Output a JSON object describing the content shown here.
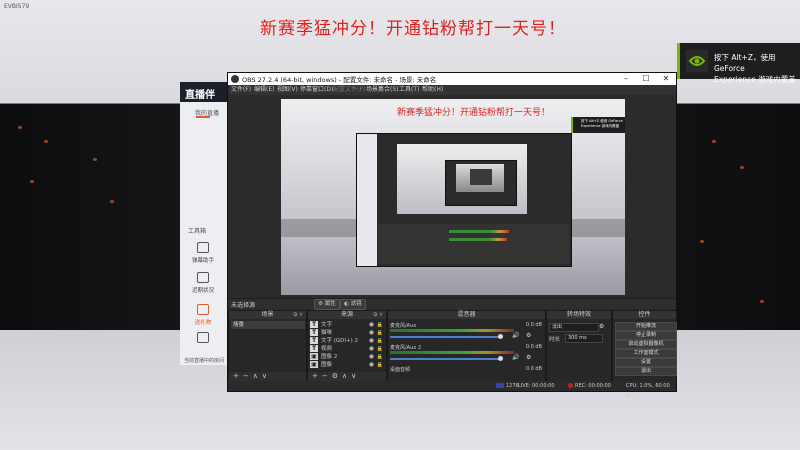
{
  "watermark": "EVBI579",
  "banner": "新赛季猛冲分！开通钻粉帮打一天号！",
  "nvidia_toast": {
    "line1": "按下 Alt+Z，使用 GeForce",
    "line2": "Experience 游戏内覆盖",
    "accent": "#76b900"
  },
  "bg_app": {
    "logo": "直播伴",
    "tab": "我的直播",
    "tools_title": "工具箱",
    "tools": [
      {
        "label": "弹幕助手"
      },
      {
        "label": "我的直播"
      },
      {
        "label": "送礼物"
      },
      {
        "label": "近期状况"
      }
    ],
    "footer": "当前直播中的房间"
  },
  "obs": {
    "title": "OBS 27.2.4 (64-bit, windows) - 配置文件: 未命名 - 场景: 未命名",
    "menu": [
      "文件(F)",
      "编辑(E)",
      "视图(V)",
      "停靠窗口(D)",
      "配置文件(P)",
      "场景集合(S)",
      "工具(T)",
      "帮助(H)"
    ],
    "preview_banner": "新赛季猛冲分！开通钻粉帮打一天号！",
    "preview_toast": "按下 Alt+Z 使用 GeForce Experience 游戏内覆盖",
    "no_source": "未选择源",
    "properties_btn": "属性",
    "filters_btn": "滤镜",
    "docks": {
      "scenes": {
        "title": "场景",
        "items": [
          "场景"
        ]
      },
      "sources": {
        "title": "来源",
        "items": [
          {
            "label": "文字"
          },
          {
            "label": "猫咪"
          },
          {
            "label": "文字 (GDI+) 2"
          },
          {
            "label": "视频"
          },
          {
            "label": "图像 2"
          },
          {
            "label": "图像"
          }
        ]
      },
      "mixer": {
        "title": "混音器",
        "channels": [
          {
            "name": "麦克风/Aux",
            "db": "0.0 dB",
            "level": 0.72
          },
          {
            "name": "麦克风/Aux 2",
            "db": "0.0 dB",
            "level": 0.7
          },
          {
            "name": "桌面音频",
            "db": "0.0 dB",
            "level": 0.0
          }
        ]
      },
      "transitions": {
        "title": "转场特效",
        "type": "淡出",
        "duration_label": "时长",
        "duration": "300 ms"
      },
      "controls": {
        "title": "控件",
        "buttons": [
          "开始推流",
          "停止录制",
          "启动虚拟摄像机",
          "工作室模式",
          "设置",
          "退出"
        ]
      }
    },
    "status": {
      "live": "LIVE: 00:00:00",
      "rec": "REC: 00:00:00",
      "cpu": "CPU: 1.0%, 60.00 fps",
      "kbps": "1276"
    }
  }
}
